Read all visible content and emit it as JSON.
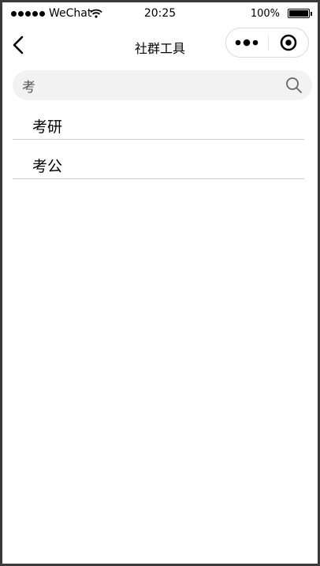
{
  "status_bar": {
    "carrier": "WeChat",
    "time": "20:25",
    "battery_percent": "100%",
    "signal_icon": "signal-dots-icon",
    "wifi_icon": "wifi-icon",
    "battery_icon": "battery-icon"
  },
  "nav": {
    "title": "社群工具",
    "back_icon": "chevron-left-icon",
    "more_icon": "more-dots-icon",
    "close_icon": "target-close-icon"
  },
  "search": {
    "value": "考",
    "placeholder": "",
    "icon": "search-icon"
  },
  "results": [
    {
      "label": "考研"
    },
    {
      "label": "考公"
    }
  ],
  "colors": {
    "frame": "#3a3a3a",
    "background": "#ffffff",
    "search_bg": "#f2f2f2",
    "divider": "#cfcfcf",
    "capsule_border": "#d9d9d9"
  }
}
